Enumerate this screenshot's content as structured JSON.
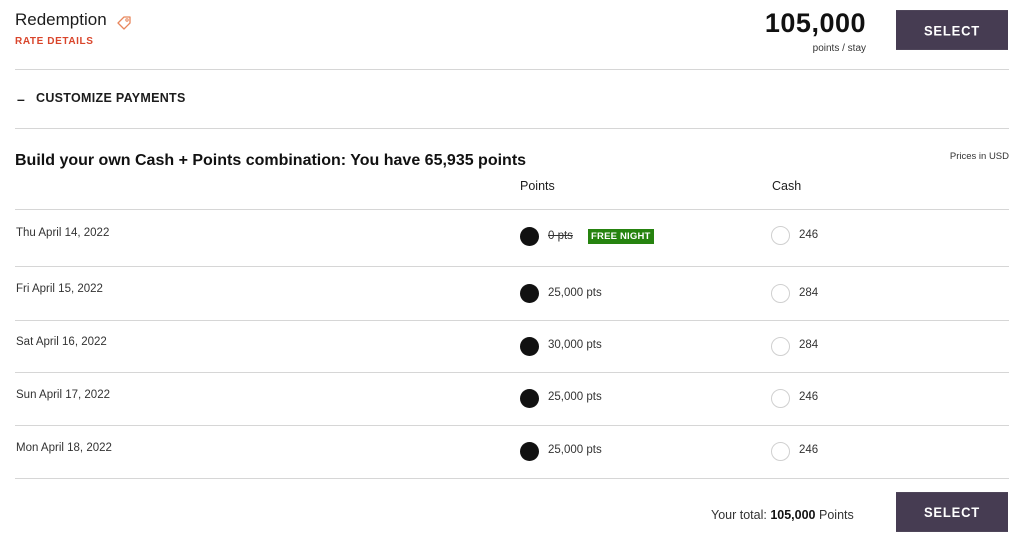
{
  "rate": {
    "title": "Redemption",
    "details_link": "RATE DETAILS",
    "points": "105,000",
    "points_unit": "points / stay",
    "select_label": "SELECT"
  },
  "customize": {
    "toggle_symbol": "–",
    "label": "CUSTOMIZE PAYMENTS"
  },
  "builder": {
    "heading": "Build your own Cash + Points combination: You have 65,935 points",
    "currency_note": "Prices in USD",
    "col_points": "Points",
    "col_cash": "Cash"
  },
  "nights": [
    {
      "date": "Thu April 14, 2022",
      "points": "0 pts",
      "badge": "FREE NIGHT",
      "cash": "246",
      "selected": "points"
    },
    {
      "date": "Fri April 15, 2022",
      "points": "25,000 pts",
      "cash": "284",
      "selected": "points"
    },
    {
      "date": "Sat April 16, 2022",
      "points": "30,000 pts",
      "cash": "284",
      "selected": "points"
    },
    {
      "date": "Sun April 17, 2022",
      "points": "25,000 pts",
      "cash": "246",
      "selected": "points"
    },
    {
      "date": "Mon April 18, 2022",
      "points": "25,000 pts",
      "cash": "246",
      "selected": "points"
    }
  ],
  "footer": {
    "total_prefix": "Your total:",
    "total_value": "105,000",
    "total_suffix": "Points",
    "select_label": "SELECT"
  },
  "colors": {
    "accent_button": "#463c52",
    "rate_details": "#d9452b",
    "free_night_badge": "#26830f"
  }
}
